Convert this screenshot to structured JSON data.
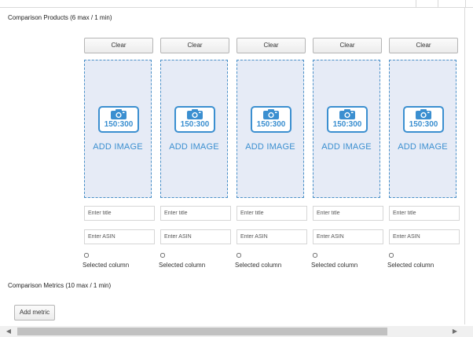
{
  "comparison_products": {
    "title": "Comparison Products (6 max / 1 min)",
    "columns": [
      {
        "clear_label": "Clear",
        "image_ratio": "150:300",
        "add_image_label": "ADD IMAGE",
        "title_placeholder": "Enter title",
        "asin_placeholder": "Enter ASIN",
        "selected_label": "Selected column"
      },
      {
        "clear_label": "Clear",
        "image_ratio": "150:300",
        "add_image_label": "ADD IMAGE",
        "title_placeholder": "Enter title",
        "asin_placeholder": "Enter ASIN",
        "selected_label": "Selected column"
      },
      {
        "clear_label": "Clear",
        "image_ratio": "150:300",
        "add_image_label": "ADD IMAGE",
        "title_placeholder": "Enter title",
        "asin_placeholder": "Enter ASIN",
        "selected_label": "Selected column"
      },
      {
        "clear_label": "Clear",
        "image_ratio": "150:300",
        "add_image_label": "ADD IMAGE",
        "title_placeholder": "Enter title",
        "asin_placeholder": "Enter ASIN",
        "selected_label": "Selected column"
      },
      {
        "clear_label": "Clear",
        "image_ratio": "150:300",
        "add_image_label": "ADD IMAGE",
        "title_placeholder": "Enter title",
        "asin_placeholder": "Enter ASIN",
        "selected_label": "Selected column"
      }
    ]
  },
  "comparison_metrics": {
    "title": "Comparison Metrics (10 max / 1 min)",
    "add_metric_label": "Add metric"
  },
  "icons": {
    "image_placeholder": "camera-icon",
    "scroll_left": "chevron-left-icon",
    "scroll_right": "chevron-right-icon"
  },
  "colors": {
    "accent": "#3b8fd0",
    "dropzone_bg": "#e6ebf6",
    "dropzone_border": "#4a90c8"
  }
}
